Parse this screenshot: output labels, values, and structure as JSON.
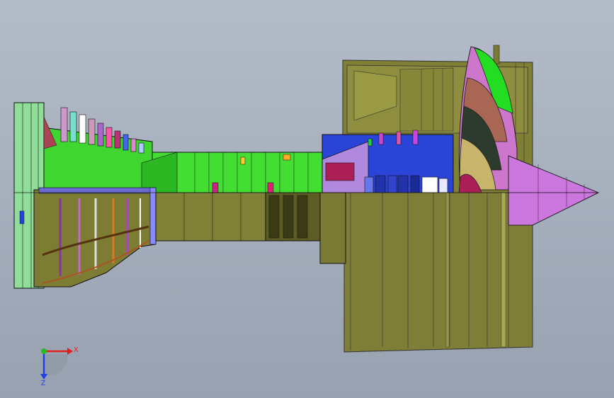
{
  "viewport": {
    "background_top": "#b4bcc9",
    "background_bottom": "#98a1b0",
    "model_colors": {
      "casing": "#8b8b3c",
      "casing_dark": "#6f6f2c",
      "compressor": "#33dd22",
      "hp_section": "#2244dd",
      "fan_nose": "#cc77dd",
      "nacelle": "#7d7d3a"
    }
  },
  "triad": {
    "x_label": "X",
    "z_label": "Z",
    "x_color": "#e02020",
    "z_color": "#2040e0",
    "y_color": "#20c020",
    "icon": "coordinate-triad-icon"
  }
}
